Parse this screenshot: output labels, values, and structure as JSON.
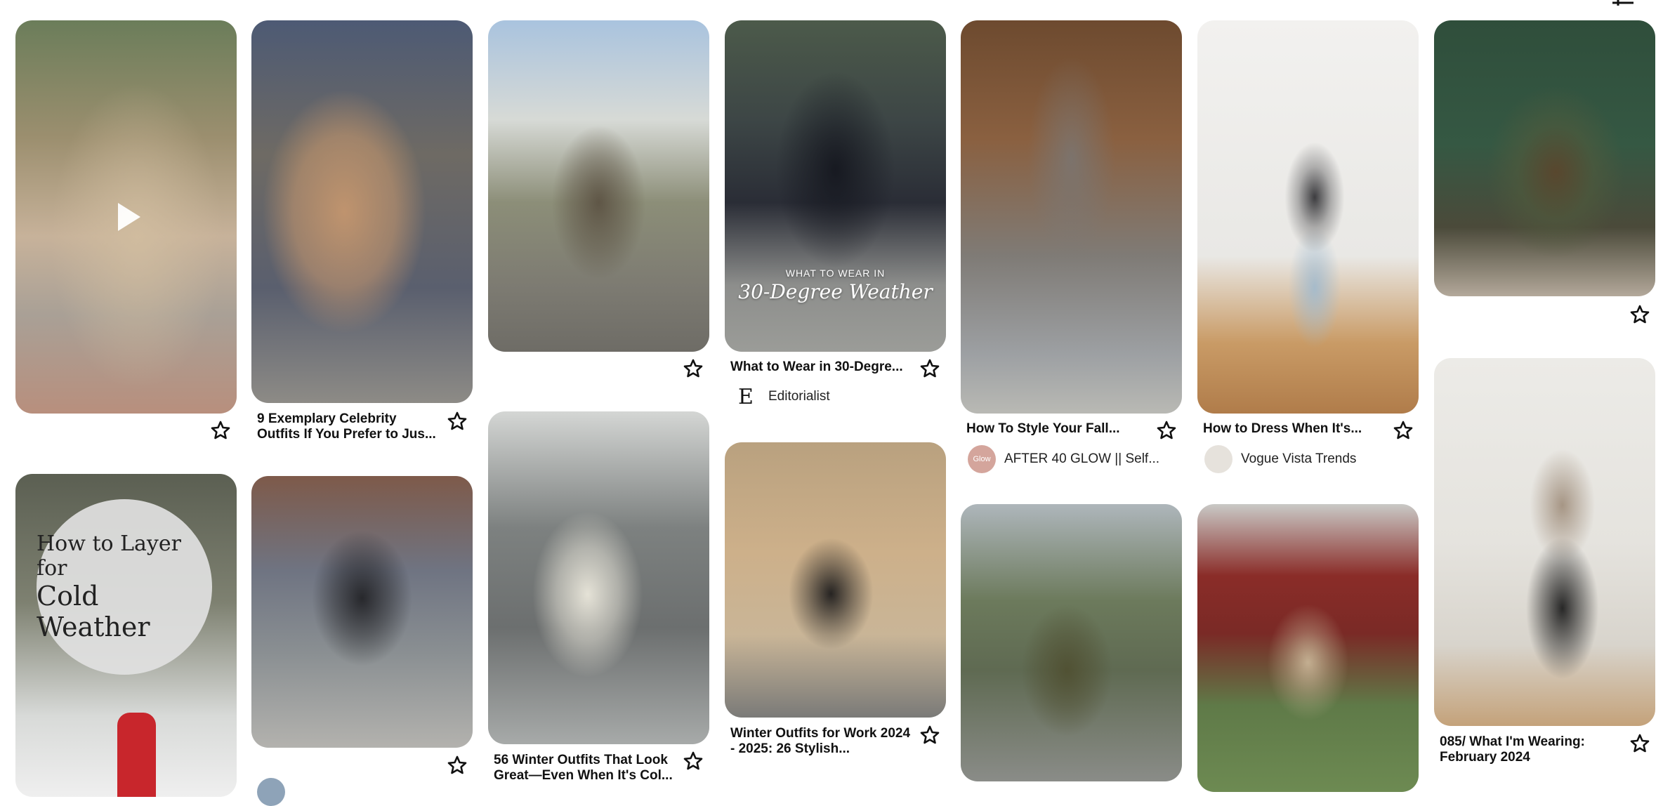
{
  "colors": {
    "background": "#ffffff",
    "text": "#111111",
    "star_stroke": "#111111"
  },
  "pins": [
    {
      "id": "p1",
      "kind": "video",
      "title": "",
      "creator": ""
    },
    {
      "id": "p2",
      "title": "9 Exemplary Celebrity Outfits If You Prefer to Jus..."
    },
    {
      "id": "p3",
      "title": ""
    },
    {
      "id": "p4",
      "title": "What to Wear in 30-Degre...",
      "overlay_line1": "WHAT TO WEAR IN",
      "overlay_line2": "30-Degree Weather",
      "creator": "Editorialist",
      "creator_avatar_letter": "E"
    },
    {
      "id": "p5",
      "title": "How To Style Your Fall...",
      "creator": "AFTER 40 GLOW || Self...",
      "creator_avatar_letter": "Glow"
    },
    {
      "id": "p6",
      "title": "How to Dress When It's...",
      "creator": "Vogue Vista Trends"
    },
    {
      "id": "p7",
      "title": ""
    },
    {
      "id": "p8",
      "title": "",
      "badge_line1": "How to Layer for",
      "badge_line2": "Cold Weather"
    },
    {
      "id": "p9",
      "title": ""
    },
    {
      "id": "p10",
      "title": "56 Winter Outfits That Look Great—Even When It's Col..."
    },
    {
      "id": "p11",
      "title": "Winter Outfits for Work 2024 - 2025: 26 Stylish..."
    },
    {
      "id": "p12",
      "title": ""
    },
    {
      "id": "p13",
      "title": ""
    },
    {
      "id": "p14",
      "title": "085/ What I'm Wearing: February 2024"
    }
  ]
}
